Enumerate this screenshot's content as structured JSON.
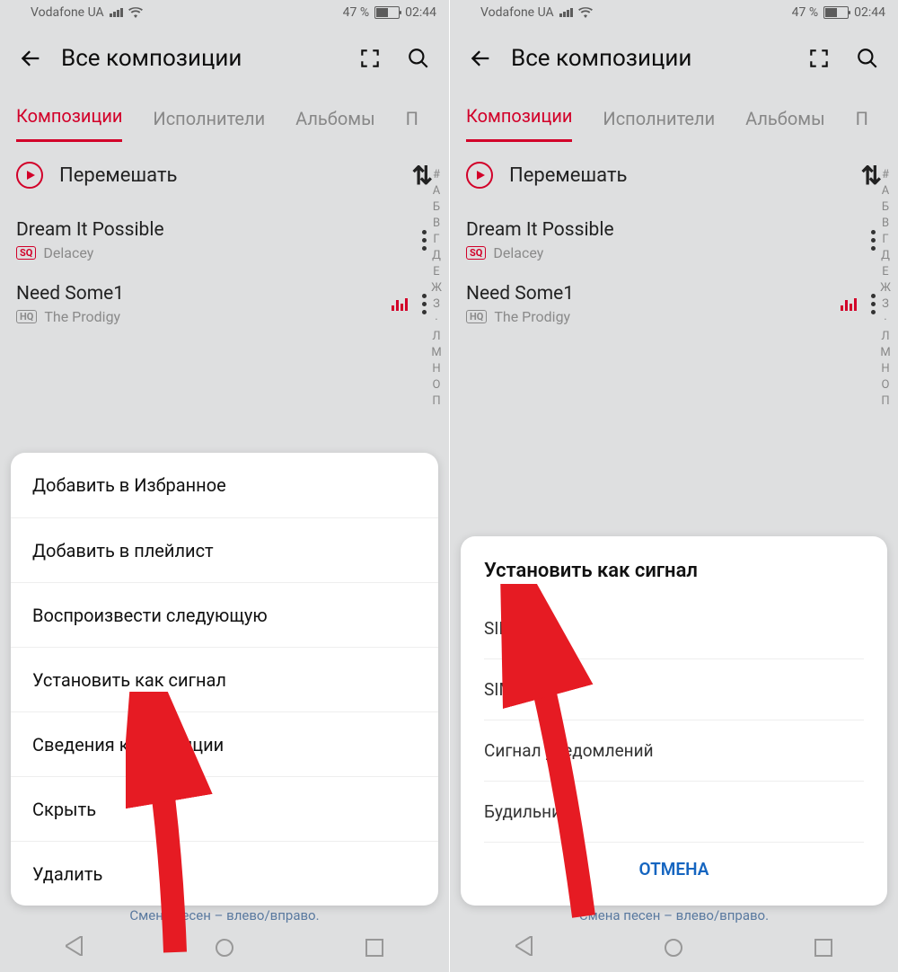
{
  "statusbar": {
    "carrier": "Vodafone UA",
    "battery_pct": "47 %",
    "time": "02:44"
  },
  "header": {
    "title": "Все композиции"
  },
  "tabs": [
    "Композиции",
    "Исполнители",
    "Альбомы",
    "П"
  ],
  "shuffle_label": "Перемешать",
  "songs": [
    {
      "title": "Dream It Possible",
      "artist": "Delacey",
      "badge": "SQ",
      "playing": false
    },
    {
      "title": "Need Some1",
      "artist": "The Prodigy",
      "badge": "HQ",
      "playing": true
    }
  ],
  "alpha_index": [
    "#",
    "А",
    "Б",
    "В",
    "Г",
    "Д",
    "Е",
    "Ж",
    "З",
    "·",
    "Л",
    "М",
    "Н",
    "О",
    "П"
  ],
  "context_menu": [
    "Добавить в Избранное",
    "Добавить в плейлист",
    "Воспроизвести следующую",
    "Установить как сигнал",
    "Сведения композиции",
    "Скрыть",
    "Удалить"
  ],
  "dialog": {
    "title": "Установить как сигнал",
    "options": [
      "SIM 1",
      "SIM 2",
      "Сигнал уведомлений",
      "Будильник"
    ],
    "cancel": "ОТМЕНА"
  },
  "hint": "Смена песен – влево/вправо."
}
